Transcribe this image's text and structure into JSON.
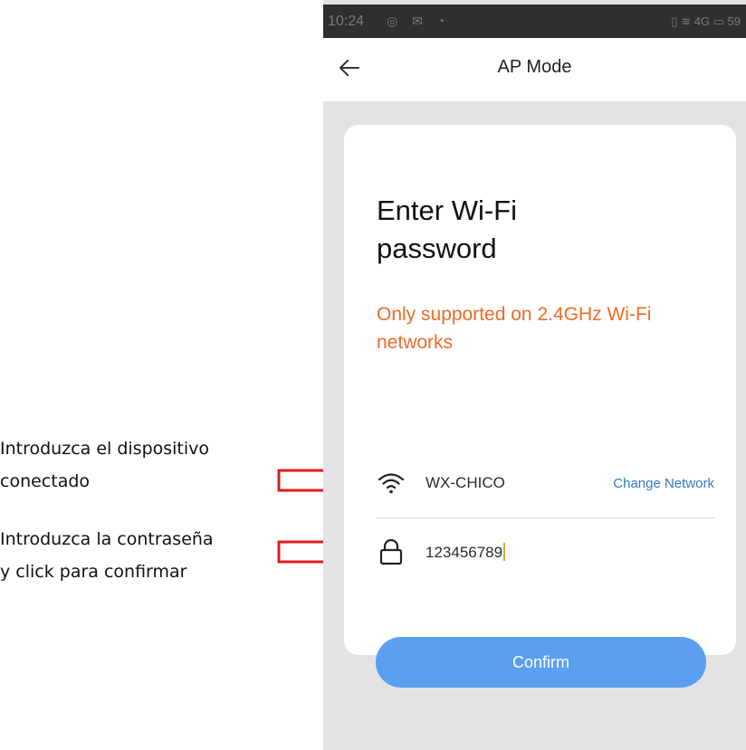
{
  "statusbar": {
    "time": "10:24",
    "left_icons": "◎ ✉ ◔",
    "right_icons": "▯ ≋ 4G ▭ 59"
  },
  "navbar": {
    "title": "AP Mode",
    "back_icon": "arrow-left"
  },
  "card": {
    "heading": "Enter Wi-Fi\npassword",
    "notice": "Only supported on 2.4GHz Wi-Fi networks",
    "wifi": {
      "icon": "wifi",
      "ssid": "WX-CHICO",
      "change_label": "Change Network"
    },
    "password": {
      "icon": "lock",
      "value": "123456789"
    },
    "confirm_label": "Confirm"
  },
  "annotations": [
    {
      "lines": [
        "Introduzca el dispositivo",
        "conectado"
      ]
    },
    {
      "lines": [
        "Introduzca la contraseña",
        "y click para confirmar"
      ]
    }
  ],
  "colors": {
    "accent_orange": "#ef6a26",
    "button_blue": "#5a9ff0",
    "link_blue": "#3478c4",
    "arrow_red": "#e01b1b"
  }
}
